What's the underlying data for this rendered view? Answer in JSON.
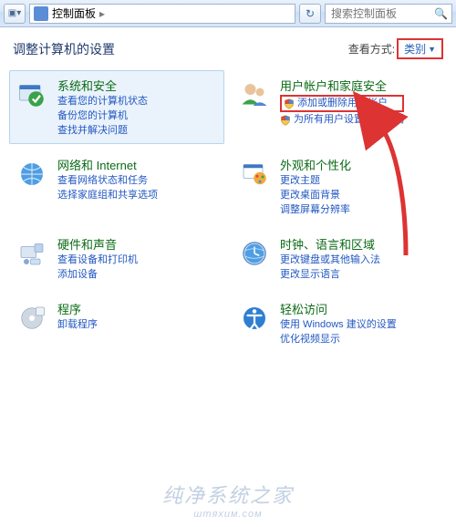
{
  "nav": {
    "crumb": "控制面板",
    "search_placeholder": "搜索控制面板"
  },
  "page": {
    "heading": "调整计算机的设置",
    "view_by_label": "查看方式:",
    "view_by_value": "类别"
  },
  "cats": {
    "sys": {
      "title": "系统和安全",
      "l1": "查看您的计算机状态",
      "l2": "备份您的计算机",
      "l3": "查找并解决问题"
    },
    "net": {
      "title": "网络和 Internet",
      "l1": "查看网络状态和任务",
      "l2": "选择家庭组和共享选项"
    },
    "hw": {
      "title": "硬件和声音",
      "l1": "查看设备和打印机",
      "l2": "添加设备"
    },
    "prog": {
      "title": "程序",
      "l1": "卸载程序"
    },
    "user": {
      "title": "用户帐户和家庭安全",
      "l1": "添加或删除用户帐户",
      "l2": "为所有用户设置家长控制"
    },
    "look": {
      "title": "外观和个性化",
      "l1": "更改主题",
      "l2": "更改桌面背景",
      "l3": "调整屏幕分辨率"
    },
    "clock": {
      "title": "时钟、语言和区域",
      "l1": "更改键盘或其他输入法",
      "l2": "更改显示语言"
    },
    "ease": {
      "title": "轻松访问",
      "l1": "使用 Windows 建议的设置",
      "l2": "优化视频显示"
    }
  },
  "watermark": {
    "main": "纯净系统之家",
    "sub": "штяхим.сом"
  }
}
